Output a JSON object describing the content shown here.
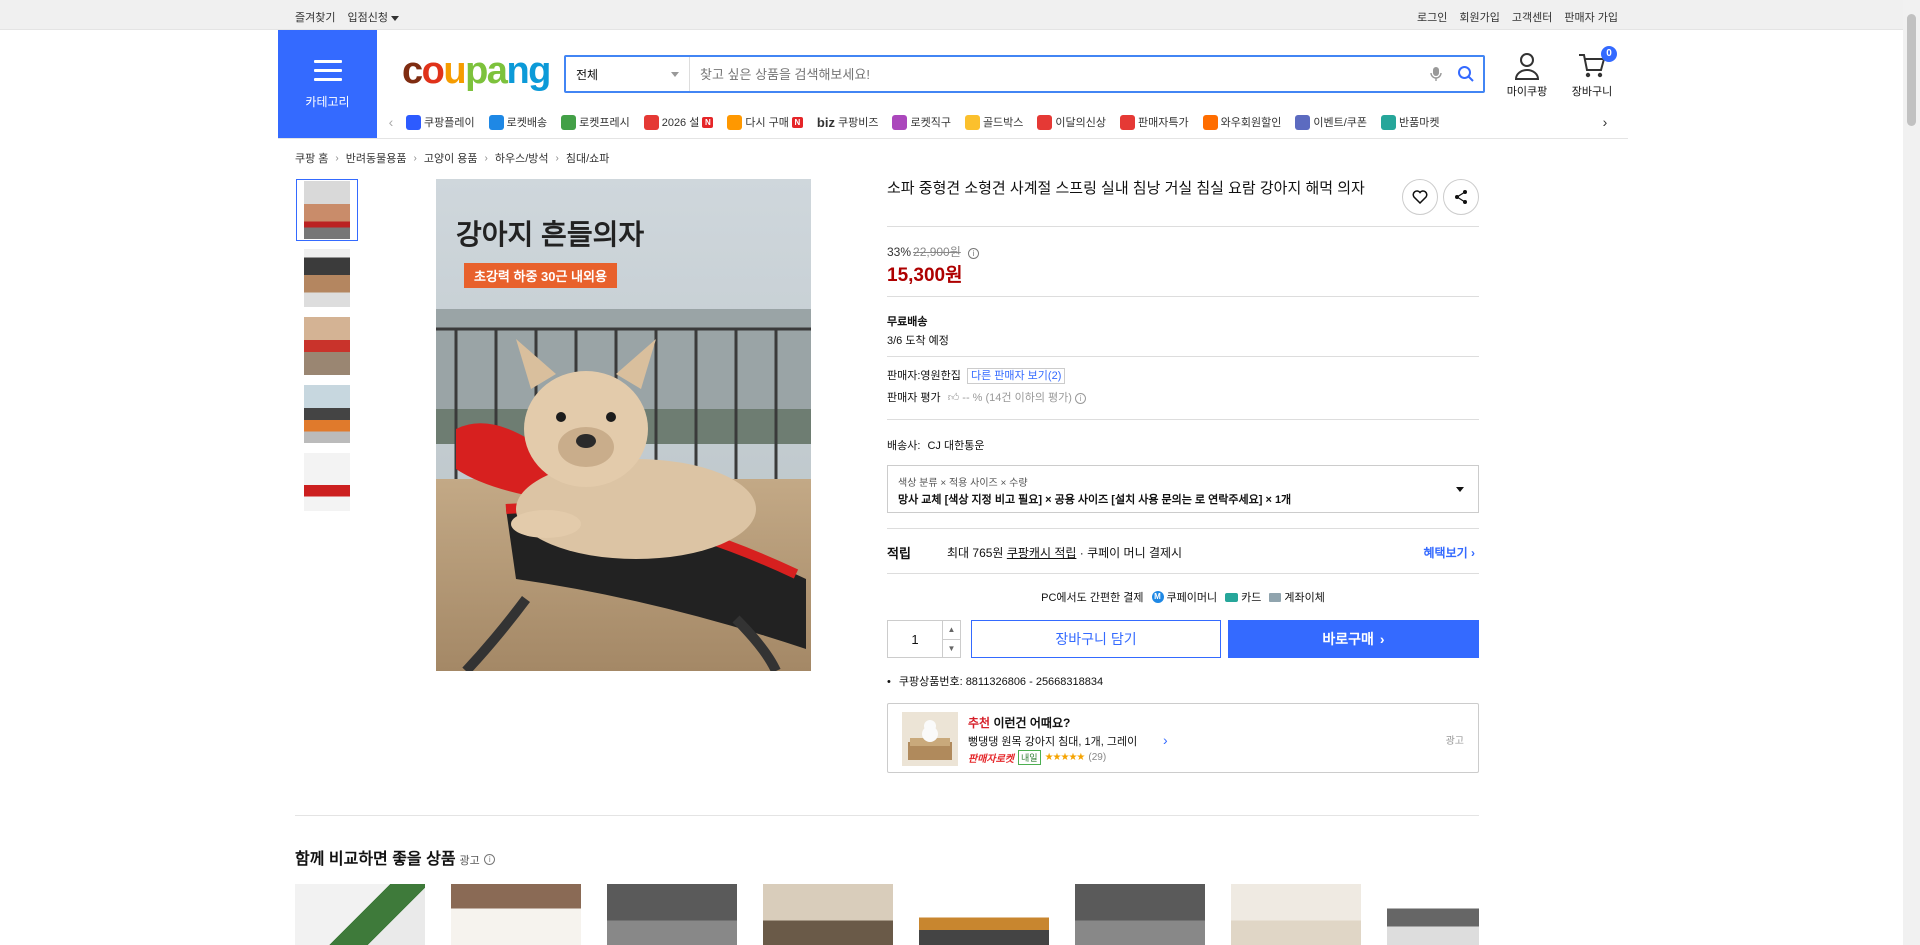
{
  "topbar": {
    "left": [
      "즐겨찾기",
      "입점신청"
    ],
    "right": [
      "로그인",
      "회원가입",
      "고객센터",
      "판매자 가입"
    ]
  },
  "header": {
    "category_label": "카테고리",
    "logo": [
      "c",
      "o",
      "u",
      "pa",
      "ng"
    ],
    "search": {
      "scope": "전체",
      "placeholder": "찾고 싶은 상품을 검색해보세요!"
    },
    "my_coupang": "마이쿠팡",
    "cart_label": "장바구니",
    "cart_count": "0"
  },
  "shortcuts": [
    {
      "label": "쿠팡플레이",
      "color": "#2d5bff"
    },
    {
      "label": "로켓배송",
      "color": "#1e88e5"
    },
    {
      "label": "로켓프레시",
      "color": "#43a047"
    },
    {
      "label": "2026 설",
      "color": "#e53935",
      "new": true
    },
    {
      "label": "다시 구매",
      "color": "#ff9800",
      "new": true
    },
    {
      "label": "쿠팡비즈",
      "color": "#333333",
      "prefix": "biz"
    },
    {
      "label": "로켓직구",
      "color": "#ab47bc"
    },
    {
      "label": "골드박스",
      "color": "#fbc02d"
    },
    {
      "label": "이달의신상",
      "color": "#e53935"
    },
    {
      "label": "판매자특가",
      "color": "#e53935"
    },
    {
      "label": "와우회원할인",
      "color": "#ff6d00"
    },
    {
      "label": "이벤트/쿠폰",
      "color": "#5c6bc0"
    },
    {
      "label": "반품마켓",
      "color": "#26a69a"
    }
  ],
  "breadcrumb": [
    "쿠팡 홈",
    "반려동물용품",
    "고양이 용품",
    "하우스/방석",
    "침대/쇼파"
  ],
  "image": {
    "headline": "강아지 흔들의자",
    "tag": "초강력 하중 30근 내외용"
  },
  "product": {
    "title": "소파 중형견 소형견 사계절 스프링 실내 침낭 거실 침실 요람 강아지 해먹 의자",
    "discount": "33%",
    "original_price": "22,900원",
    "price": "15,300원",
    "shipping_title": "무료배송",
    "arrival": "3/6 도착 예정",
    "seller_label": "판매자:",
    "seller_name": "영원한집",
    "other_sellers": "다른 판매자 보기(2)",
    "seller_rating_label": "판매자 평가",
    "seller_rating_value": "-- %",
    "seller_rating_note": "(14건 이하의 평가)",
    "courier_label": "배송사:",
    "courier_name": "CJ 대한통운",
    "option_header": "색상 분류 × 적용 사이즈 × 수량",
    "option_value": "망사 교체 [색상 지정 비고 필요] × 공용 사이즈 [설치 사용 문의는 로 연락주세요] × 1개",
    "reward_label": "적립",
    "reward_max": "최대 765원",
    "reward_link": "쿠팡캐시 적립",
    "reward_tail": "· 쿠페이 머니 결제시",
    "benefit_link": "혜택보기",
    "pay_title": "PC에서도 간편한 결제",
    "pay_methods": [
      "쿠페이머니",
      "카드",
      "계좌이체"
    ],
    "quantity": "1",
    "add_to_cart": "장바구니 담기",
    "buy_now": "바로구매",
    "product_code": "쿠팡상품번호: 8811326806 - 25668318834"
  },
  "recommend": {
    "hl": "추천",
    "title": "이런건 어때요?",
    "name": "뻥댕댕 원목 강아지 침대, 1개, 그레이",
    "badge": "판매자로켓",
    "tomorrow": "내일",
    "stars": "★★★★★",
    "rating": 5,
    "count": "(29)",
    "ad": "광고"
  },
  "compare": {
    "title": "함께 비교하면 좋을 상품",
    "ad": "광고"
  }
}
